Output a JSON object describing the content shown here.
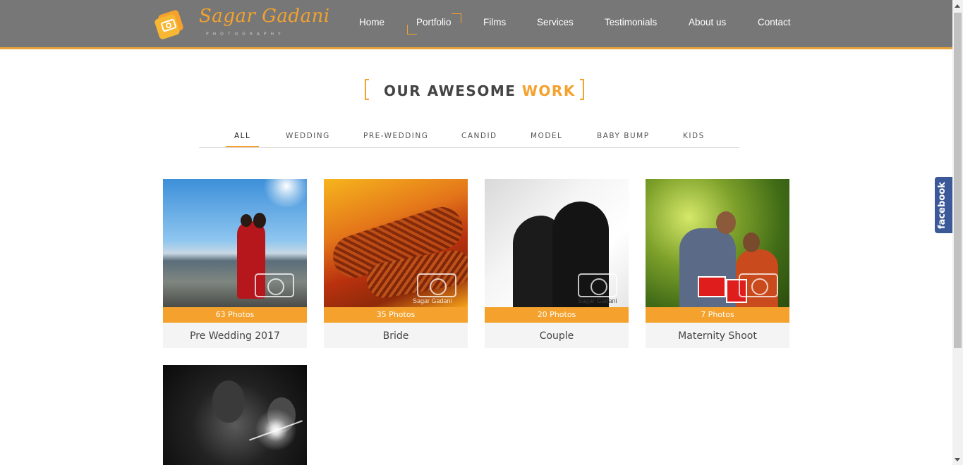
{
  "brand": {
    "name": "Sagar Gadani",
    "tagline": "PHOTOGRAPHY",
    "accent_color": "#f4a22d",
    "header_color": "#777777"
  },
  "nav": {
    "items": [
      {
        "label": "Home"
      },
      {
        "label": "Portfolio",
        "active": true
      },
      {
        "label": "Films"
      },
      {
        "label": "Services"
      },
      {
        "label": "Testimonials"
      },
      {
        "label": "About us"
      },
      {
        "label": "Contact"
      }
    ]
  },
  "section": {
    "title_part1": "OUR AWESOME",
    "title_part2": "WORK"
  },
  "filters": {
    "items": [
      {
        "label": "ALL",
        "active": true
      },
      {
        "label": "WEDDING"
      },
      {
        "label": "PRE-WEDDING"
      },
      {
        "label": "CANDID"
      },
      {
        "label": "MODEL"
      },
      {
        "label": "BABY BUMP"
      },
      {
        "label": "KIDS"
      }
    ]
  },
  "gallery": {
    "albums": [
      {
        "count": "63 Photos",
        "title": "Pre Wedding 2017",
        "thumb": "couple-on-beach"
      },
      {
        "count": "35 Photos",
        "title": "Bride",
        "thumb": "mehndi-hands"
      },
      {
        "count": "20 Photos",
        "title": "Couple",
        "thumb": "silhouette-couple"
      },
      {
        "count": "7 Photos",
        "title": "Maternity Shoot",
        "thumb": "maternity-couple"
      },
      {
        "count": "",
        "title": "",
        "thumb": "black-and-white-couple"
      }
    ],
    "watermark": "Sagar Gadani"
  },
  "social": {
    "facebook_label": "facebook"
  }
}
